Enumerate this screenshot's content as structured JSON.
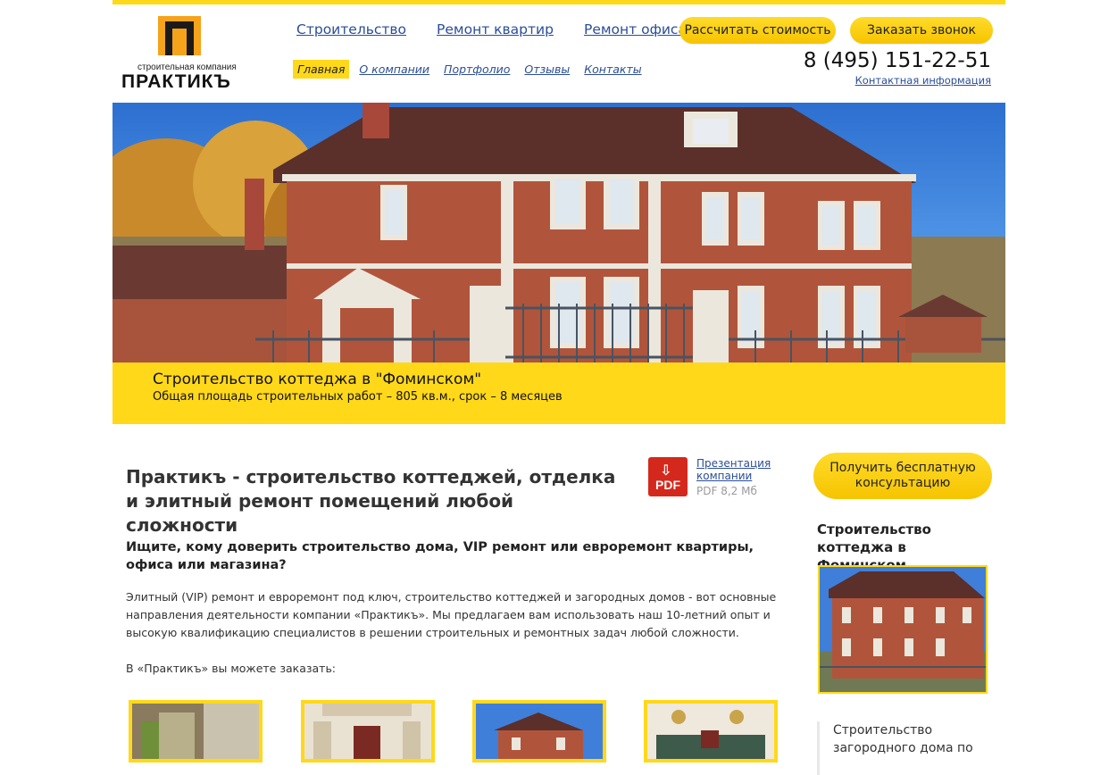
{
  "logo": {
    "subtitle": "строительная компания",
    "name": "ПРАКТИКЪ"
  },
  "main_nav": [
    {
      "label": "Строительство"
    },
    {
      "label": "Ремонт квартир"
    },
    {
      "label": "Ремонт офиса"
    }
  ],
  "header_buttons": {
    "calc": "Рассчитать стоимость",
    "call": "Заказать звонок"
  },
  "sub_nav": [
    {
      "label": "Главная",
      "active": true
    },
    {
      "label": "О компании",
      "active": false
    },
    {
      "label": "Портфолио",
      "active": false
    },
    {
      "label": "Отзывы",
      "active": false
    },
    {
      "label": "Контакты",
      "active": false
    }
  ],
  "contact": {
    "phone": "8 (495) 151-22-51",
    "link": "Контактная информация"
  },
  "hero": {
    "title": "Строительство коттеджа в \"Фоминском\"",
    "text": "Общая площадь строительных работ – 805 кв.м., срок – 8 месяцев"
  },
  "content": {
    "heading": "Практикъ - строительство коттеджей, отделка и элитный ремонт помещений любой сложности",
    "pdf": {
      "icon_label": "PDF",
      "link": "Презентация компании",
      "size": "PDF 8,2 Мб"
    },
    "subheading": "Ищите, кому доверить строительство дома, VIP ремонт или евроремонт квартиры, офиса или магазина?",
    "paragraph": "Элитный (VIP) ремонт и евроремонт под ключ, строительство коттеджей и загородных домов - вот основные направления деятельности компании «Практикъ». Мы предлагаем вам использовать наш 10-летний опыт и высокую квалификацию специалистов в решении строительных и ремонтных задач любой сложности.",
    "order_text": "В «Практикъ» вы можете заказать:"
  },
  "sidebar": {
    "consult_button": "Получить бесплатную консультацию",
    "project_title": "Строительство коттеджа в Фоминском",
    "card_text": "Строительство загородного дома по"
  },
  "colors": {
    "accent": "#ffd81a",
    "link": "#2b4e97",
    "pdf": "#d5281c",
    "logo_orange": "#f5a31a"
  }
}
